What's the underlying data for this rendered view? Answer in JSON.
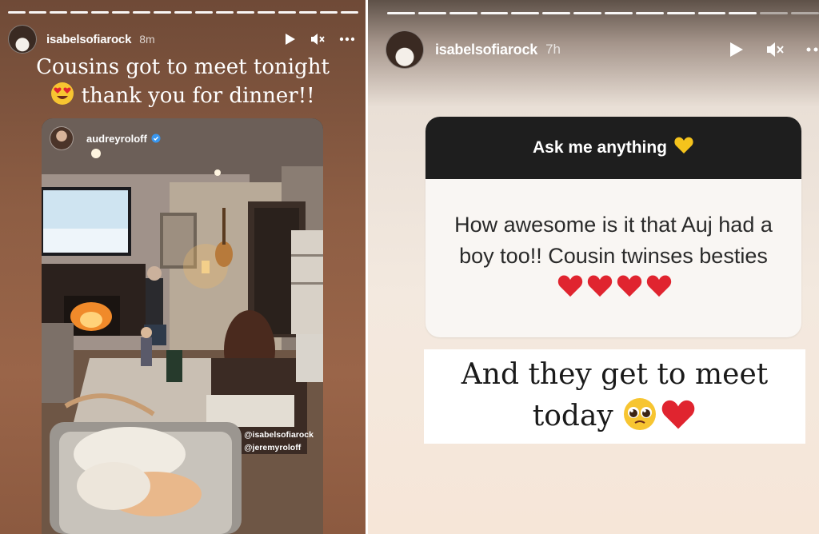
{
  "left_story": {
    "username": "isabelsofiarock",
    "time": "8m",
    "caption_line1": "Cousins got to meet tonight",
    "caption_line2": "thank you for dinner!!",
    "embedded_post": {
      "username": "audreyroloff",
      "mentions": [
        "@isabelsofiarock",
        "@jeremyroloff"
      ]
    },
    "progress_segments": 17
  },
  "right_story": {
    "username": "isabelsofiarock",
    "time": "7h",
    "question_sticker": {
      "header": "Ask me anything",
      "question": "How awesome is it that Auj had a boy too!! Cousin twinses besties"
    },
    "answer_line1": "And they get to meet",
    "answer_line2": "today",
    "progress_segments": 14
  },
  "icons": [
    "play-icon",
    "mute-icon",
    "more-icon",
    "heart-eyes-emoji",
    "yellow-heart-emoji",
    "red-heart-emoji",
    "pleading-face-emoji",
    "verified-badge-icon"
  ],
  "colors": {
    "question_header_bg": "#1e1e1e",
    "heart_red": "#e0242f",
    "yellow_heart": "#f5c31c"
  }
}
